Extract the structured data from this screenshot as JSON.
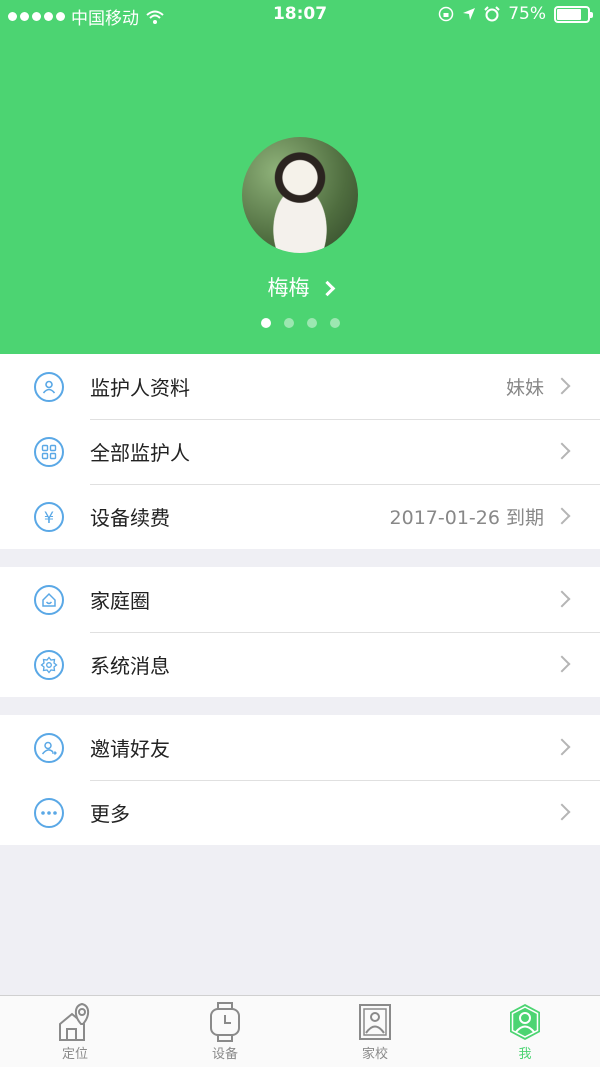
{
  "status_bar": {
    "carrier": "中国移动",
    "time": "18:07",
    "battery": "75%",
    "battery_level": 0.75
  },
  "profile": {
    "name": "梅梅",
    "avatar_icon": "user-photo",
    "pager_count": 4,
    "pager_active": 0
  },
  "groups": [
    [
      {
        "icon": "user-icon",
        "label": "监护人资料",
        "value": "妹妹"
      },
      {
        "icon": "grid-icon",
        "label": "全部监护人",
        "value": ""
      },
      {
        "icon": "yen-icon",
        "label": "设备续费",
        "value": "2017-01-26 到期"
      }
    ],
    [
      {
        "icon": "home-icon",
        "label": "家庭圈",
        "value": ""
      },
      {
        "icon": "gear-icon",
        "label": "系统消息",
        "value": ""
      }
    ],
    [
      {
        "icon": "invite-icon",
        "label": "邀请好友",
        "value": ""
      },
      {
        "icon": "more-icon",
        "label": "更多",
        "value": ""
      }
    ]
  ],
  "tabs": [
    {
      "label": "定位",
      "icon": "location-icon",
      "active": false
    },
    {
      "label": "设备",
      "icon": "watch-icon",
      "active": false
    },
    {
      "label": "家校",
      "icon": "photo-icon",
      "active": false
    },
    {
      "label": "我",
      "icon": "me-icon",
      "active": true
    }
  ],
  "colors": {
    "brand": "#4cd472",
    "icon_blue": "#5aa8e6",
    "background": "#efeff4"
  }
}
